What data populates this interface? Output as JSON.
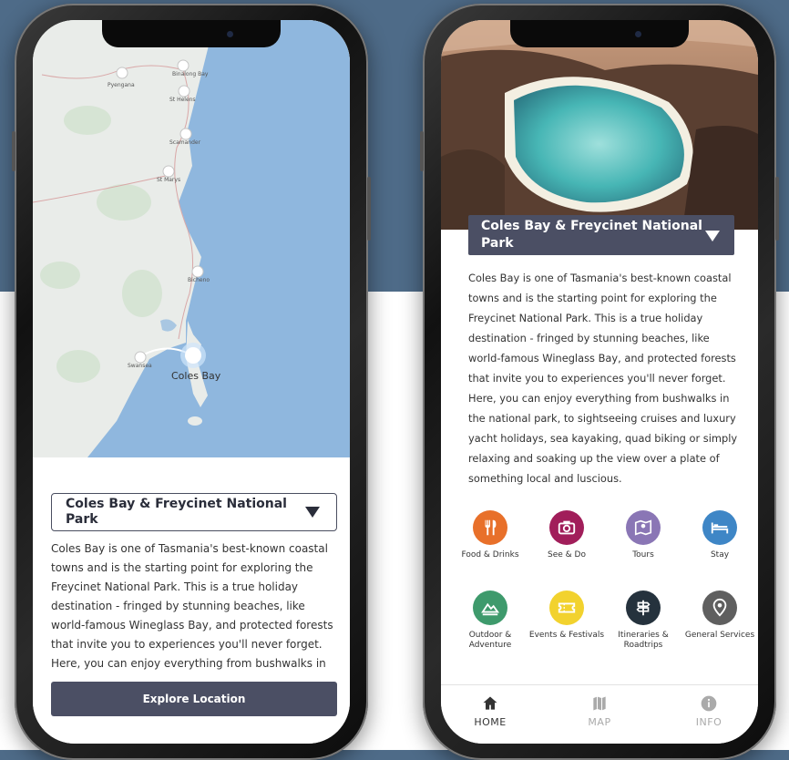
{
  "map": {
    "towns": [
      "Pyengana",
      "Binalong Bay",
      "St Helens",
      "Scamander",
      "St Marys",
      "Bicheno",
      "Swansea"
    ],
    "highlight_label": "Coles Bay"
  },
  "left_phone": {
    "location_select": "Coles Bay & Freycinet National Park",
    "description": "Coles Bay is one of Tasmania's best-known coastal towns and is the starting point for exploring the Freycinet National Park. This is a true holiday destination - fringed by stunning beaches, like world-famous Wineglass Bay, and protected forests that invite you to experiences you'll never forget. Here, you can enjoy everything from bushwalks in",
    "explore_button": "Explore Location"
  },
  "right_phone": {
    "title": "Coles Bay & Freycinet National Park",
    "description": "Coles Bay is one of Tasmania's best-known coastal towns and is the starting point for exploring the Freycinet National Park. This is a true holiday destination - fringed by stunning beaches, like world-famous Wineglass Bay, and protected forests that invite you to experiences you'll never forget. Here, you can enjoy everything from bushwalks in the national park, to sightseeing cruises and luxury yacht holidays, sea kayaking, quad biking or simply relaxing and soaking up the view over a plate of something local and luscious.",
    "categories": [
      {
        "label": "Food & Drinks",
        "icon": "fork-knife-icon",
        "color": "#e8702a"
      },
      {
        "label": "See & Do",
        "icon": "camera-icon",
        "color": "#a11e5a"
      },
      {
        "label": "Tours",
        "icon": "map-pin-icon",
        "color": "#8a76b5"
      },
      {
        "label": "Stay",
        "icon": "bed-icon",
        "color": "#3e86c6"
      },
      {
        "label": "Outdoor & Adventure",
        "icon": "mountain-icon",
        "color": "#3e9a6c"
      },
      {
        "label": "Events & Festivals",
        "icon": "ticket-icon",
        "color": "#f2d22e"
      },
      {
        "label": "Itineraries & Roadtrips",
        "icon": "signpost-icon",
        "color": "#25323d"
      },
      {
        "label": "General Services",
        "icon": "location-icon",
        "color": "#5f5f5f"
      }
    ],
    "nav": [
      {
        "label": "HOME",
        "icon": "home-icon",
        "active": true
      },
      {
        "label": "MAP",
        "icon": "map-icon",
        "active": false
      },
      {
        "label": "INFO",
        "icon": "info-icon",
        "active": false
      }
    ]
  },
  "colors": {
    "background_top": "#4e6b88",
    "button_dark": "#4b4f64",
    "ocean": "#8fb7de",
    "land": "#e9ece9"
  }
}
